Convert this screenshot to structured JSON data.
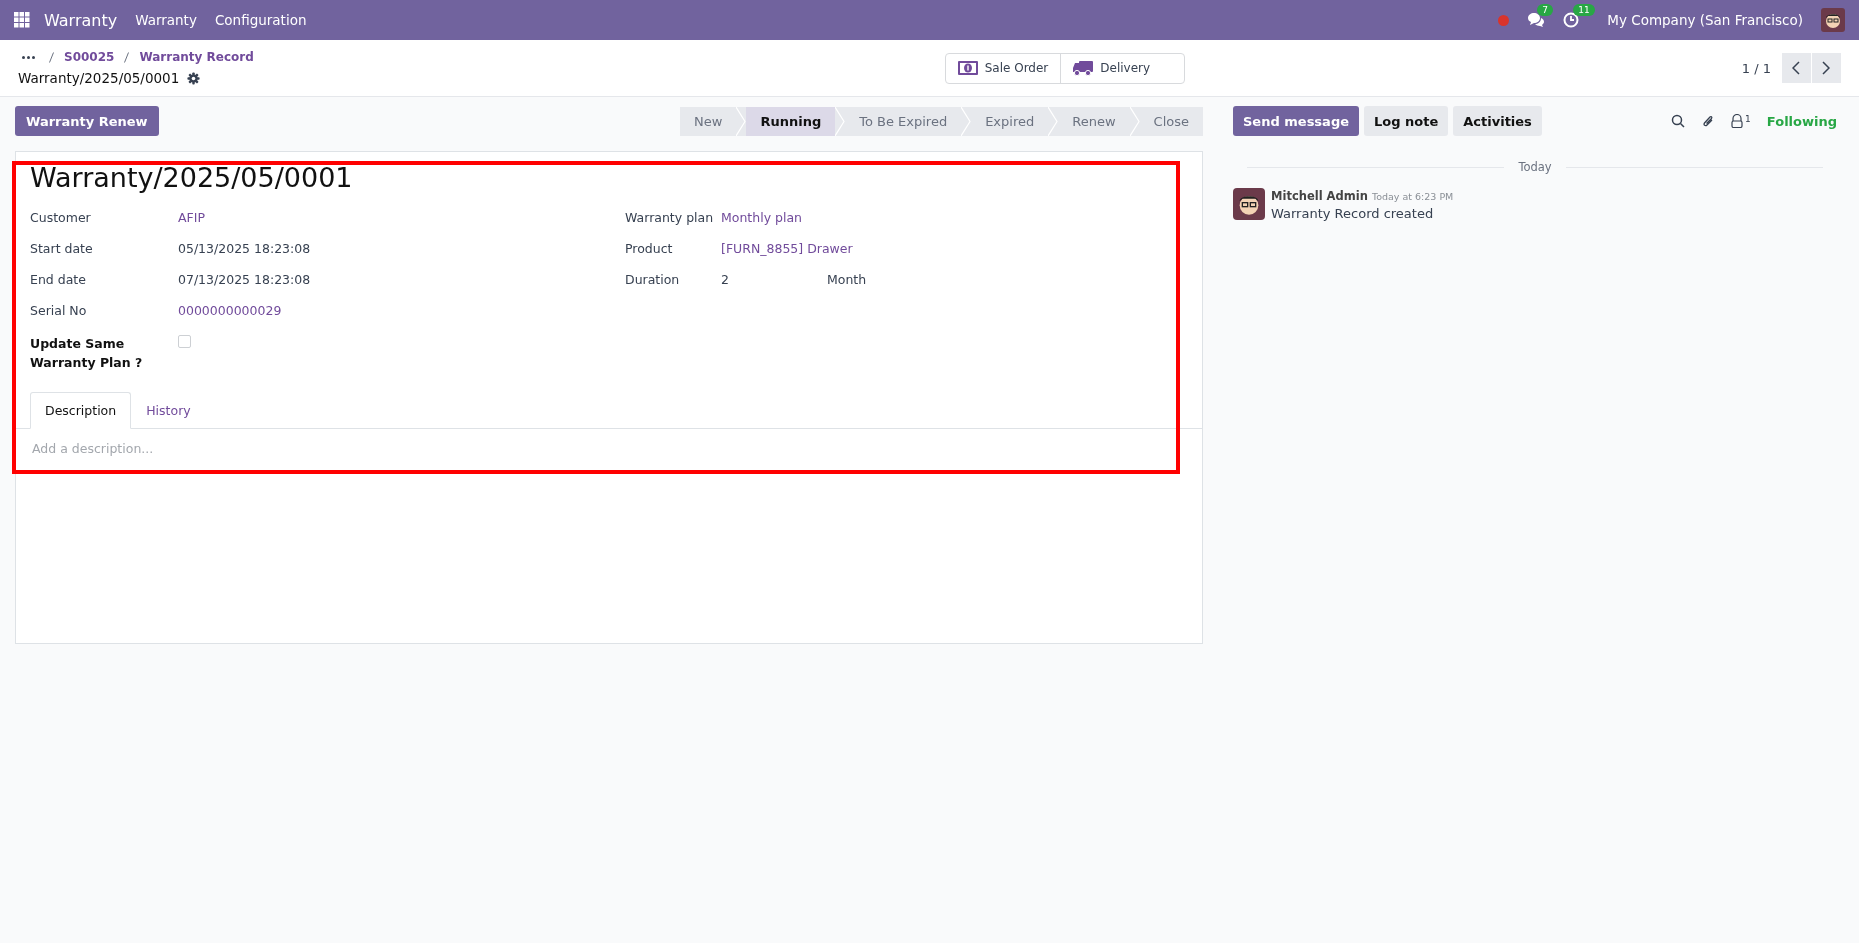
{
  "navbar": {
    "app_name": "Warranty",
    "menus": [
      "Warranty",
      "Configuration"
    ],
    "chat_count": "7",
    "activity_count": "11",
    "company": "My Company (San Francisco)"
  },
  "breadcrumbs": [
    {
      "label": "S00025"
    },
    {
      "label": "Warranty Record"
    }
  ],
  "record_title": "Warranty/2025/05/0001",
  "smart_buttons": [
    {
      "label": "Sale Order",
      "kind": "money"
    },
    {
      "label": "Delivery",
      "kind": "truck"
    }
  ],
  "pager": "1 / 1",
  "action_buttons": [
    "Warranty Renew"
  ],
  "statusbar": [
    {
      "label": "New",
      "selected": false
    },
    {
      "label": "Running",
      "selected": true
    },
    {
      "label": "To Be Expired",
      "selected": false
    },
    {
      "label": "Expired",
      "selected": false
    },
    {
      "label": "Renew",
      "selected": false
    },
    {
      "label": "Close",
      "selected": false
    }
  ],
  "form": {
    "title": "Warranty/2025/05/0001",
    "left_fields": [
      {
        "label": "Customer",
        "value": "AFIP",
        "kind": "link"
      },
      {
        "label": "Start date",
        "value": "05/13/2025 18:23:08",
        "kind": "text"
      },
      {
        "label": "End date",
        "value": "07/13/2025 18:23:08",
        "kind": "text"
      },
      {
        "label": "Serial No",
        "value": "0000000000029",
        "kind": "link"
      },
      {
        "label": "Update Same Warranty Plan ?",
        "kind": "checkbox",
        "checked": false
      }
    ],
    "right_fields": [
      {
        "label": "Warranty plan",
        "value": "Monthly plan",
        "kind": "link"
      },
      {
        "label": "Product",
        "value": "[FURN_8855] Drawer",
        "kind": "link"
      },
      {
        "label": "Duration",
        "value": "2",
        "unit": "Month",
        "kind": "duration"
      }
    ],
    "tabs": [
      {
        "label": "Description",
        "selected": true
      },
      {
        "label": "History",
        "selected": false
      }
    ],
    "description": {
      "placeholder": "Add a description..."
    }
  },
  "chatter": {
    "buttons": [
      {
        "label": "Send message",
        "kind": "primary"
      },
      {
        "label": "Log note",
        "kind": "secondary"
      },
      {
        "label": "Activities",
        "kind": "secondary"
      }
    ],
    "followers_count": "1",
    "follow_label": "Following",
    "date_separator": "Today",
    "messages": [
      {
        "author": "Mitchell Admin",
        "time": "Today at 6:23 PM",
        "body": "Warranty Record created"
      }
    ]
  }
}
